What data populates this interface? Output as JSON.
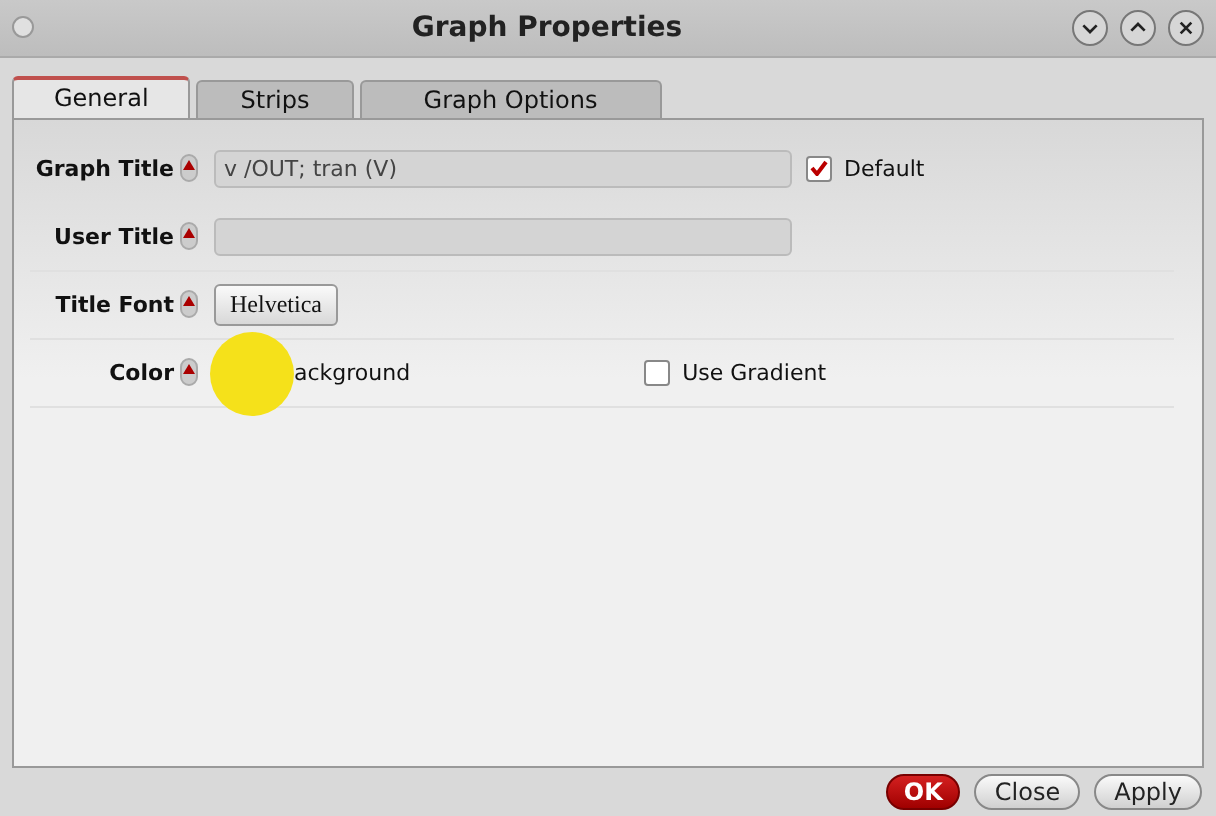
{
  "window": {
    "title": "Graph Properties"
  },
  "tabs": [
    {
      "label": "General",
      "selected": true
    },
    {
      "label": "Strips",
      "selected": false
    },
    {
      "label": "Graph Options",
      "selected": false
    }
  ],
  "rows": [
    {
      "kind": "field",
      "label": "Graph Title",
      "value": "v /OUT; tran (V)",
      "option": {
        "label": "Default",
        "checked": true
      }
    },
    {
      "kind": "field",
      "label": "User Title",
      "value": ""
    },
    {
      "kind": "button",
      "label": "Title Font",
      "value": "Helvetica"
    },
    {
      "kind": "color",
      "label": "Color",
      "value": "ackground",
      "option": {
        "label": "Use Gradient",
        "checked": false
      }
    }
  ],
  "buttons": [
    {
      "label": "OK",
      "kind": "primary"
    },
    {
      "label": "Close",
      "kind": "normal"
    },
    {
      "label": "Apply",
      "kind": "normal"
    }
  ]
}
